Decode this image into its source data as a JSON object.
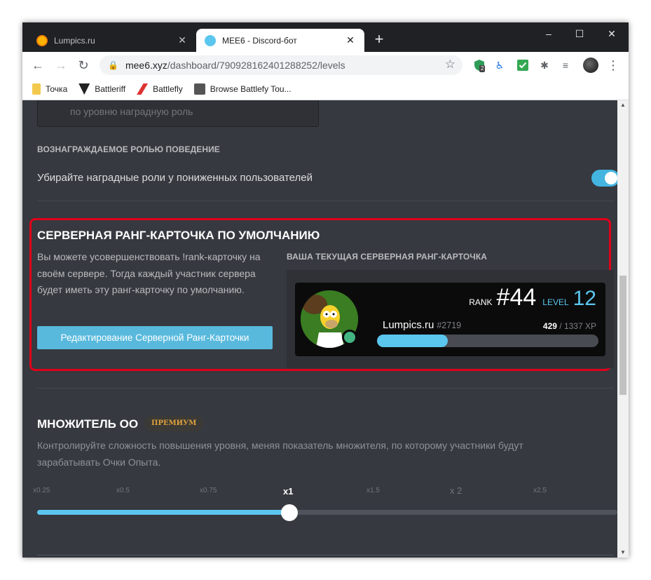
{
  "browser": {
    "tabs": [
      {
        "title": "Lumpics.ru",
        "active": false
      },
      {
        "title": "MEE6 - Discord-бот",
        "active": true
      }
    ],
    "new_tab": "+",
    "window_buttons": {
      "minimize": "–",
      "maximize": "☐",
      "close": "✕"
    },
    "url": {
      "host": "mee6.xyz",
      "path": "/dashboard/790928162401288252/levels"
    },
    "extension_badge": "2",
    "bookmarks": [
      {
        "label": "Точка",
        "icon": "folder-icon"
      },
      {
        "label": "Battleriff",
        "icon": "battleriff-icon"
      },
      {
        "label": "Battlefly",
        "icon": "battlefly-icon"
      },
      {
        "label": "Browse Battlefy Tou...",
        "icon": "battlefy-icon"
      }
    ]
  },
  "page": {
    "role_placeholder": "по уровню наградную роль",
    "behavior_heading": "ВОЗНАГРАЖДАЕМОЕ РОЛЬЮ ПОВЕДЕНИЕ",
    "behavior_label": "Убирайте наградные роли у пониженных пользователей",
    "behavior_toggle_on": true,
    "rank_card": {
      "title": "СЕРВЕРНАЯ РАНГ-КАРТОЧКА ПО УМОЛЧАНИЮ",
      "description": "Вы можете усовершенствовать !rank-карточку на своём сервере. Тогда каждый участник сервера будет иметь эту ранг-карточку по умолчанию.",
      "edit_button": "Редактирование Серверной Ранг-Карточки",
      "current_heading": "ВАША ТЕКУЩАЯ СЕРВЕРНАЯ РАНГ-КАРТОЧКА",
      "preview": {
        "rank_label": "RANK",
        "rank": "#44",
        "level_label": "LEVEL",
        "level": "12",
        "username": "Lumpics.ru",
        "discriminator": "#2719",
        "xp_current": "429",
        "xp_total": "/ 1337 XP",
        "progress_fraction": 0.32,
        "status_color": "#43b581",
        "accent_color": "#5bc6ee"
      }
    },
    "multiplier": {
      "title": "МНОЖИТЕЛЬ ОО",
      "badge": "ПРЕМИУМ",
      "description": "Контролируйте сложность повышения уровня, меняя показатель множителя, по которому участники будут зарабатывать Очки Опыта.",
      "ticks": [
        "x0.25",
        "x0.5",
        "x0.75",
        "x1",
        "x1.5",
        "x 2",
        "x2.5"
      ],
      "selected": "x1",
      "slider_fraction": 0.435
    }
  }
}
